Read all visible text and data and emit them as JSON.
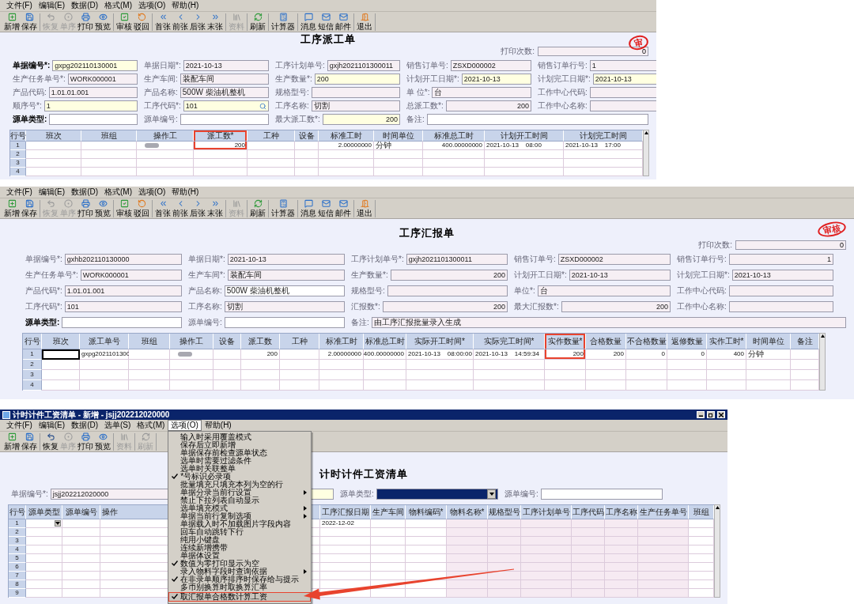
{
  "panels": [
    {
      "menu": [
        {
          "label": "文件(F)"
        },
        {
          "label": "编辑(E)"
        },
        {
          "label": "数据(D)"
        },
        {
          "label": "格式(M)"
        },
        {
          "label": "选项(O)"
        },
        {
          "label": "帮助(H)"
        }
      ],
      "toolbar": [
        [
          {
            "label": "新增",
            "kind": "add",
            "disabled": false
          },
          {
            "label": "保存",
            "kind": "save",
            "disabled": false
          }
        ],
        [
          {
            "label": "恢复",
            "kind": "undo",
            "disabled": true
          },
          {
            "label": "单序",
            "kind": "order",
            "disabled": true
          },
          {
            "label": "打印",
            "kind": "print",
            "disabled": false
          },
          {
            "label": "预览",
            "kind": "preview",
            "disabled": false
          }
        ],
        [
          {
            "label": "审核",
            "kind": "approve",
            "disabled": false
          },
          {
            "label": "驳回",
            "kind": "reject",
            "disabled": false
          }
        ],
        [
          {
            "label": "首张",
            "kind": "first",
            "disabled": false
          },
          {
            "label": "前张",
            "kind": "prev",
            "disabled": false
          },
          {
            "label": "后张",
            "kind": "next",
            "disabled": false
          },
          {
            "label": "末张",
            "kind": "last",
            "disabled": false
          }
        ],
        [
          {
            "label": "资料",
            "kind": "material",
            "disabled": true
          }
        ],
        [
          {
            "label": "刷新",
            "kind": "refresh",
            "disabled": false
          }
        ],
        [
          {
            "label": "计算器",
            "kind": "calculator",
            "disabled": false
          }
        ],
        [
          {
            "label": "消息",
            "kind": "message",
            "disabled": false
          },
          {
            "label": "短信",
            "kind": "sms",
            "disabled": false
          },
          {
            "label": "邮件",
            "kind": "mail",
            "disabled": false
          }
        ],
        [
          {
            "label": "退出",
            "kind": "exit",
            "disabled": false
          }
        ]
      ],
      "title": "工序派工单",
      "stamp": "审",
      "print_count": {
        "label": "打印次数:",
        "value": "0"
      },
      "form": [
        [
          {
            "label": "单据编号*:",
            "value": "gxpg202110130001",
            "kind": "input",
            "bold": true,
            "wide": false
          },
          {
            "label": "单据日期*:",
            "value": "2021-10-13",
            "kind": "readonly",
            "bold": false,
            "wide": false
          },
          {
            "label": "工序计划单号:",
            "value": "gxjh2021101300011",
            "kind": "readonly",
            "bold": false,
            "wide": false
          },
          {
            "label": "销售订单号:",
            "value": "ZSXD000002",
            "kind": "readonly",
            "bold": false,
            "wide": false
          },
          {
            "label": "销售订单行号:",
            "value": "1",
            "kind": "readonly",
            "bold": false,
            "wide": false
          }
        ],
        [
          {
            "label": "生产任务单号*:",
            "value": "WORK000001",
            "kind": "readonly",
            "bold": false,
            "wide": false
          },
          {
            "label": "生产车间:",
            "value": "装配车间",
            "kind": "readonly",
            "bold": false,
            "wide": false
          },
          {
            "label": "生产数量*:",
            "value": "200",
            "kind": "input",
            "bold": false,
            "wide": false
          },
          {
            "label": "计划开工日期*:",
            "value": "2021-10-13",
            "kind": "input",
            "bold": false,
            "wide": false
          },
          {
            "label": "计划完工日期*:",
            "value": "2021-10-13",
            "kind": "input",
            "bold": false,
            "wide": false
          }
        ],
        [
          {
            "label": "产品代码:",
            "value": "1.01.01.001",
            "kind": "readonly",
            "bold": false,
            "wide": false
          },
          {
            "label": "产品名称:",
            "value": "500W 柴油机整机",
            "kind": "readonly",
            "bold": false,
            "wide": false
          },
          {
            "label": "规格型号:",
            "kind": "readonly",
            "bold": false,
            "wide": false
          },
          {
            "label": "单 位*:",
            "value": "台",
            "kind": "readonly",
            "bold": false,
            "wide": false
          },
          {
            "label": "工作中心代码:",
            "kind": "readonly",
            "bold": false,
            "wide": false
          }
        ],
        [
          {
            "label": "顺序号*:",
            "value": "1",
            "kind": "input",
            "bold": false,
            "wide": false
          },
          {
            "label": "工序代码*:",
            "value": "101",
            "kind": "lookup",
            "bold": false,
            "wide": false
          },
          {
            "label": "工序名称:",
            "value": "切割",
            "kind": "readonly",
            "bold": false,
            "wide": false
          },
          {
            "label": "总派工数*:",
            "value": "200",
            "kind": "total",
            "bold": false,
            "wide": false
          },
          {
            "label": "工作中心名称:",
            "kind": "readonly",
            "bold": false,
            "wide": false
          }
        ],
        [
          {
            "label": "源单类型:",
            "kind": "blank",
            "bold": true,
            "wide": false
          },
          {
            "label": "源单编号:",
            "kind": "blank",
            "bold": false,
            "wide": false
          },
          {
            "label": "最大派工数*:",
            "value": "200",
            "kind": "amount",
            "bold": false,
            "wide": false
          },
          {
            "label": "备注:",
            "kind": "blank",
            "bold": false,
            "wide": true
          }
        ]
      ],
      "table": {
        "columns": [
          {
            "label": "行号",
            "kind": "rownum"
          },
          {
            "label": "班次",
            "kind": "plain"
          },
          {
            "label": "班组",
            "kind": "plain"
          },
          {
            "label": "操作工",
            "kind": "operator"
          },
          {
            "label": "派工数*",
            "kind": "highlighted"
          },
          {
            "label": "工种",
            "kind": "plain"
          },
          {
            "label": "设备",
            "kind": "plain"
          },
          {
            "label": "标准工时",
            "kind": "plain"
          },
          {
            "label": "时间单位",
            "kind": "plain"
          },
          {
            "label": "标准总工时",
            "kind": "plain"
          },
          {
            "label": "计划开工时间",
            "kind": "plain"
          },
          {
            "label": "计划完工时间",
            "kind": "plain"
          }
        ],
        "rows": [
          {
            "cells": [
              "1",
              null,
              null,
              null,
              "200",
              null,
              null,
              "2.00000000",
              "分钟",
              "400.00000000",
              "2021-10-13    08:00",
              "2021-10-13    17:00"
            ],
            "redacted": true
          },
          {
            "cells": [
              "2"
            ],
            "redacted": false
          },
          {
            "cells": [
              "3"
            ],
            "redacted": false
          },
          {
            "cells": [
              "4"
            ],
            "redacted": false
          }
        ]
      }
    },
    {
      "menu": [
        {
          "label": "文件(F)"
        },
        {
          "label": "编辑(E)"
        },
        {
          "label": "数据(D)"
        },
        {
          "label": "格式(M)"
        },
        {
          "label": "选项(O)"
        },
        {
          "label": "帮助(H)"
        }
      ],
      "toolbar": [
        [
          {
            "label": "新增",
            "kind": "add",
            "disabled": false
          },
          {
            "label": "保存",
            "kind": "save",
            "disabled": false
          }
        ],
        [
          {
            "label": "恢复",
            "kind": "undo",
            "disabled": true
          },
          {
            "label": "单序",
            "kind": "order",
            "disabled": true
          },
          {
            "label": "打印",
            "kind": "print",
            "disabled": false
          },
          {
            "label": "预览",
            "kind": "preview",
            "disabled": false
          }
        ],
        [
          {
            "label": "审核",
            "kind": "approve",
            "disabled": false
          },
          {
            "label": "驳回",
            "kind": "reject",
            "disabled": false
          }
        ],
        [
          {
            "label": "首张",
            "kind": "first",
            "disabled": false
          },
          {
            "label": "前张",
            "kind": "prev",
            "disabled": false
          },
          {
            "label": "后张",
            "kind": "next",
            "disabled": false
          },
          {
            "label": "末张",
            "kind": "last",
            "disabled": false
          }
        ],
        [
          {
            "label": "资料",
            "kind": "material",
            "disabled": true
          }
        ],
        [
          {
            "label": "刷新",
            "kind": "refresh",
            "disabled": false
          }
        ],
        [
          {
            "label": "计算器",
            "kind": "calculator",
            "disabled": false
          }
        ],
        [
          {
            "label": "消息",
            "kind": "message",
            "disabled": false
          },
          {
            "label": "短信",
            "kind": "sms",
            "disabled": false
          },
          {
            "label": "邮件",
            "kind": "mail",
            "disabled": false
          }
        ],
        [
          {
            "label": "退出",
            "kind": "exit",
            "disabled": false
          }
        ]
      ],
      "title": "工序汇报单",
      "stamp": "审核",
      "print_count": {
        "label": "打印次数:",
        "value": "0"
      },
      "form": [
        [
          {
            "label": "单据编号*:",
            "value": "gxhb202110130000",
            "kind": "readonly",
            "bold": false,
            "wide": false
          },
          {
            "label": "单据日期*:",
            "value": "2021-10-13",
            "kind": "readonly",
            "bold": false,
            "wide": false
          },
          {
            "label": "工序计划单号*:",
            "value": "gxjh2021101300011",
            "kind": "readonly",
            "bold": false,
            "wide": false
          },
          {
            "label": "销售订单号:",
            "value": "ZSXD000002",
            "kind": "readonly",
            "bold": false,
            "wide": false
          },
          {
            "label": "销售订单行号:",
            "value": "1",
            "kind": "total",
            "bold": false,
            "wide": false
          }
        ],
        [
          {
            "label": "生产任务单号*:",
            "value": "WORK000001",
            "kind": "readonly",
            "bold": false,
            "wide": false
          },
          {
            "label": "生产车间*:",
            "value": "装配车间",
            "kind": "readonly",
            "bold": false,
            "wide": false
          },
          {
            "label": "生产数量*:",
            "value": "200",
            "kind": "total",
            "bold": false,
            "wide": false
          },
          {
            "label": "计划开工日期*:",
            "value": "2021-10-13",
            "kind": "readonly",
            "bold": false,
            "wide": false
          },
          {
            "label": "计划完工日期*:",
            "value": "2021-10-13",
            "kind": "readonly",
            "bold": false,
            "wide": false
          }
        ],
        [
          {
            "label": "产品代码*:",
            "value": "1.01.01.001",
            "kind": "readonly",
            "bold": false,
            "wide": false
          },
          {
            "label": "产品名称:",
            "value": "500W 柴油机整机",
            "kind": "blank",
            "bold": false,
            "wide": false
          },
          {
            "label": "规格型号:",
            "kind": "readonly",
            "bold": false,
            "wide": false
          },
          {
            "label": "单位*:",
            "value": "台",
            "kind": "readonly",
            "bold": false,
            "wide": false
          },
          {
            "label": "工作中心代码:",
            "kind": "readonly",
            "bold": false,
            "wide": false
          }
        ],
        [
          {
            "label": "工序代码*:",
            "value": "101",
            "kind": "readonly",
            "bold": false,
            "wide": false
          },
          {
            "label": "工序名称:",
            "value": "切割",
            "kind": "readonly",
            "bold": false,
            "wide": false
          },
          {
            "label": "汇报数*:",
            "value": "200",
            "kind": "total",
            "bold": false,
            "wide": false
          },
          {
            "label": "最大汇报数*:",
            "value": "200",
            "kind": "total",
            "bold": false,
            "wide": false
          },
          {
            "label": "工作中心名称:",
            "kind": "readonly",
            "bold": false,
            "wide": false
          }
        ],
        [
          {
            "label": "源单类型:",
            "kind": "blank",
            "bold": true,
            "wide": false
          },
          {
            "label": "源单编号:",
            "kind": "blank",
            "bold": false,
            "wide": false
          },
          {
            "label": "备注:",
            "value": "由工序汇报批量录入生成",
            "kind": "readonly",
            "bold": false,
            "wide": true
          }
        ]
      ],
      "table": {
        "columns": [
          {
            "label": "行号",
            "kind": "rownum"
          },
          {
            "label": "班次",
            "kind": "plain"
          },
          {
            "label": "派工单号",
            "kind": "plain"
          },
          {
            "label": "班组",
            "kind": "plain"
          },
          {
            "label": "操作工",
            "kind": "operator"
          },
          {
            "label": "设备",
            "kind": "plain"
          },
          {
            "label": "派工数",
            "kind": "plain"
          },
          {
            "label": "工种",
            "kind": "plain"
          },
          {
            "label": "标准工时",
            "kind": "plain"
          },
          {
            "label": "标准总工时",
            "kind": "plain"
          },
          {
            "label": "实际开工时间*",
            "kind": "plain"
          },
          {
            "label": "实际完工时间*",
            "kind": "plain"
          },
          {
            "label": "实作数量*",
            "kind": "highlighted"
          },
          {
            "label": "合格数量",
            "kind": "plain"
          },
          {
            "label": "不合格数量",
            "kind": "plain"
          },
          {
            "label": "返修数量",
            "kind": "plain"
          },
          {
            "label": "实作工时*",
            "kind": "plain"
          },
          {
            "label": "时间单位",
            "kind": "plain"
          },
          {
            "label": "备注",
            "kind": "plain"
          }
        ],
        "rows": [
          {
            "cells": [
              "1",
              null,
              "gxpg2021101300",
              null,
              null,
              null,
              "200",
              null,
              "2.00000000",
              "400.00000000",
              "2021-10-13    08:00:00",
              "2021-10-13    14:59:34",
              "200",
              "200",
              "0",
              "0",
              "400",
              "分钟"
            ],
            "redacted": true,
            "focused": true
          },
          {
            "cells": [
              "2"
            ],
            "redacted": false,
            "focused": false
          },
          {
            "cells": [
              "3"
            ],
            "redacted": false,
            "focused": false
          },
          {
            "cells": [
              "4"
            ],
            "redacted": false,
            "focused": false
          }
        ]
      }
    },
    {
      "window_title": "计时计件工资清单 - 新增 - jsjj202212020000",
      "menu": [
        {
          "label": "文件(F)",
          "open": false
        },
        {
          "label": "编辑(E)",
          "open": false
        },
        {
          "label": "数据(D)",
          "open": false
        },
        {
          "label": "选单(S)",
          "open": false
        },
        {
          "label": "格式(M)",
          "open": false
        },
        {
          "label": "选项(O)",
          "open": true
        },
        {
          "label": "帮助(H)",
          "open": false
        }
      ],
      "toolbar": [
        [
          {
            "label": "新增",
            "kind": "add",
            "disabled": false
          },
          {
            "label": "保存",
            "kind": "save",
            "disabled": false
          }
        ],
        [
          {
            "label": "恢复",
            "kind": "undo",
            "disabled": false
          },
          {
            "label": "单序",
            "kind": "order",
            "disabled": true
          },
          {
            "label": "打印",
            "kind": "print",
            "disabled": false
          },
          {
            "label": "预览",
            "kind": "preview",
            "disabled": false
          }
        ],
        [
          {
            "label": "资料",
            "kind": "material",
            "disabled": true
          }
        ],
        [
          {
            "label": "刷新",
            "kind": "refresh",
            "disabled": true
          }
        ]
      ],
      "title": "计时计件工资清单",
      "form": [
        [
          {
            "label": "单据编号*:",
            "value": "jsjj202212020000",
            "kind": "readonly",
            "bold": false,
            "wide": false
          },
          {
            "kind": "input",
            "wide": false
          },
          {
            "label": "源单类型:",
            "kind": "select",
            "bold": false,
            "wide": false
          },
          {
            "label": "源单编号:",
            "kind": "blank",
            "bold": false,
            "wide": false
          }
        ]
      ],
      "table": {
        "columns": [
          {
            "label": "行号",
            "kind": "rownum"
          },
          {
            "label": "源单类型",
            "kind": "select"
          },
          {
            "label": "源单编号",
            "kind": "plain"
          },
          {
            "label": "操作",
            "kind": "covered"
          },
          {
            "label": "工序汇报日期",
            "kind": "plain"
          },
          {
            "label": "生产车间",
            "kind": "plain"
          },
          {
            "label": "物料编码*",
            "kind": "plain"
          },
          {
            "label": "物料名称*",
            "kind": "readonly"
          },
          {
            "label": "规格型号",
            "kind": "readonly"
          },
          {
            "label": "工序计划单号",
            "kind": "readonly"
          },
          {
            "label": "工序代码",
            "kind": "readonly"
          },
          {
            "label": "工序名称",
            "kind": "readonly"
          },
          {
            "label": "生产任务单号",
            "kind": "readonly"
          },
          {
            "label": "班组",
            "kind": "plain"
          }
        ],
        "rows": [
          {
            "cells": [
              "1",
              null,
              null,
              null,
              "2022-12-02"
            ],
            "dropdown": true
          },
          {
            "cells": [
              "2"
            ],
            "dropdown": false
          },
          {
            "cells": [
              "3"
            ],
            "dropdown": false
          },
          {
            "cells": [
              "4"
            ],
            "dropdown": false
          },
          {
            "cells": [
              "5"
            ],
            "dropdown": false
          },
          {
            "cells": [
              "6"
            ],
            "dropdown": false
          },
          {
            "cells": [
              "7"
            ],
            "dropdown": false
          },
          {
            "cells": [
              "8"
            ],
            "dropdown": false
          },
          {
            "cells": [
              "9"
            ],
            "dropdown": false
          }
        ]
      },
      "dropdown_menu": [
        {
          "label": "输入时采用覆盖模式",
          "checked": false,
          "submenu": false,
          "highlighted": false
        },
        {
          "label": "保存后立即新增",
          "checked": false,
          "submenu": false,
          "highlighted": false
        },
        {
          "label": "单据保存前检查源单状态",
          "checked": false,
          "submenu": false,
          "highlighted": false
        },
        {
          "label": "选单时需要过滤条件",
          "checked": false,
          "submenu": false,
          "highlighted": false
        },
        {
          "label": "选单时关联整单",
          "checked": false,
          "submenu": false,
          "highlighted": false
        },
        {
          "label": "*号标识必录项",
          "checked": true,
          "submenu": false,
          "highlighted": false
        },
        {
          "label": "批量填充只填充本列为空的行",
          "checked": false,
          "submenu": false,
          "highlighted": false
        },
        {
          "label": "单据分录当前行设置",
          "checked": false,
          "submenu": true,
          "highlighted": false
        },
        {
          "label": "禁止下拉列表自动显示",
          "checked": false,
          "submenu": false,
          "highlighted": false
        },
        {
          "label": "选单填充模式",
          "checked": false,
          "submenu": true,
          "highlighted": false
        },
        {
          "label": "单据当前行复制选项",
          "checked": false,
          "submenu": true,
          "highlighted": false
        },
        {
          "label": "单据载入时不加载图片字段内容",
          "checked": false,
          "submenu": false,
          "highlighted": false
        },
        {
          "label": "回车自动跳转下行",
          "checked": false,
          "submenu": false,
          "highlighted": false
        },
        {
          "label": "纯用小键盘",
          "checked": false,
          "submenu": false,
          "highlighted": false
        },
        {
          "label": "连续新增携带",
          "checked": false,
          "submenu": false,
          "highlighted": false
        },
        {
          "label": "单据体设置",
          "checked": false,
          "submenu": false,
          "highlighted": false
        },
        {
          "label": "数值为零打印显示为空",
          "checked": true,
          "submenu": false,
          "highlighted": false
        },
        {
          "label": "录入物料字段时查询依据",
          "checked": false,
          "submenu": true,
          "highlighted": false
        },
        {
          "label": "在非录单顺序排序时保存给与提示",
          "checked": true,
          "submenu": false,
          "highlighted": false
        },
        {
          "label": "多币别换算时取换算汇率",
          "checked": false,
          "submenu": false,
          "highlighted": false
        },
        {
          "label": "取汇报单合格数计算工资",
          "checked": true,
          "submenu": false,
          "highlighted": true
        }
      ]
    }
  ]
}
